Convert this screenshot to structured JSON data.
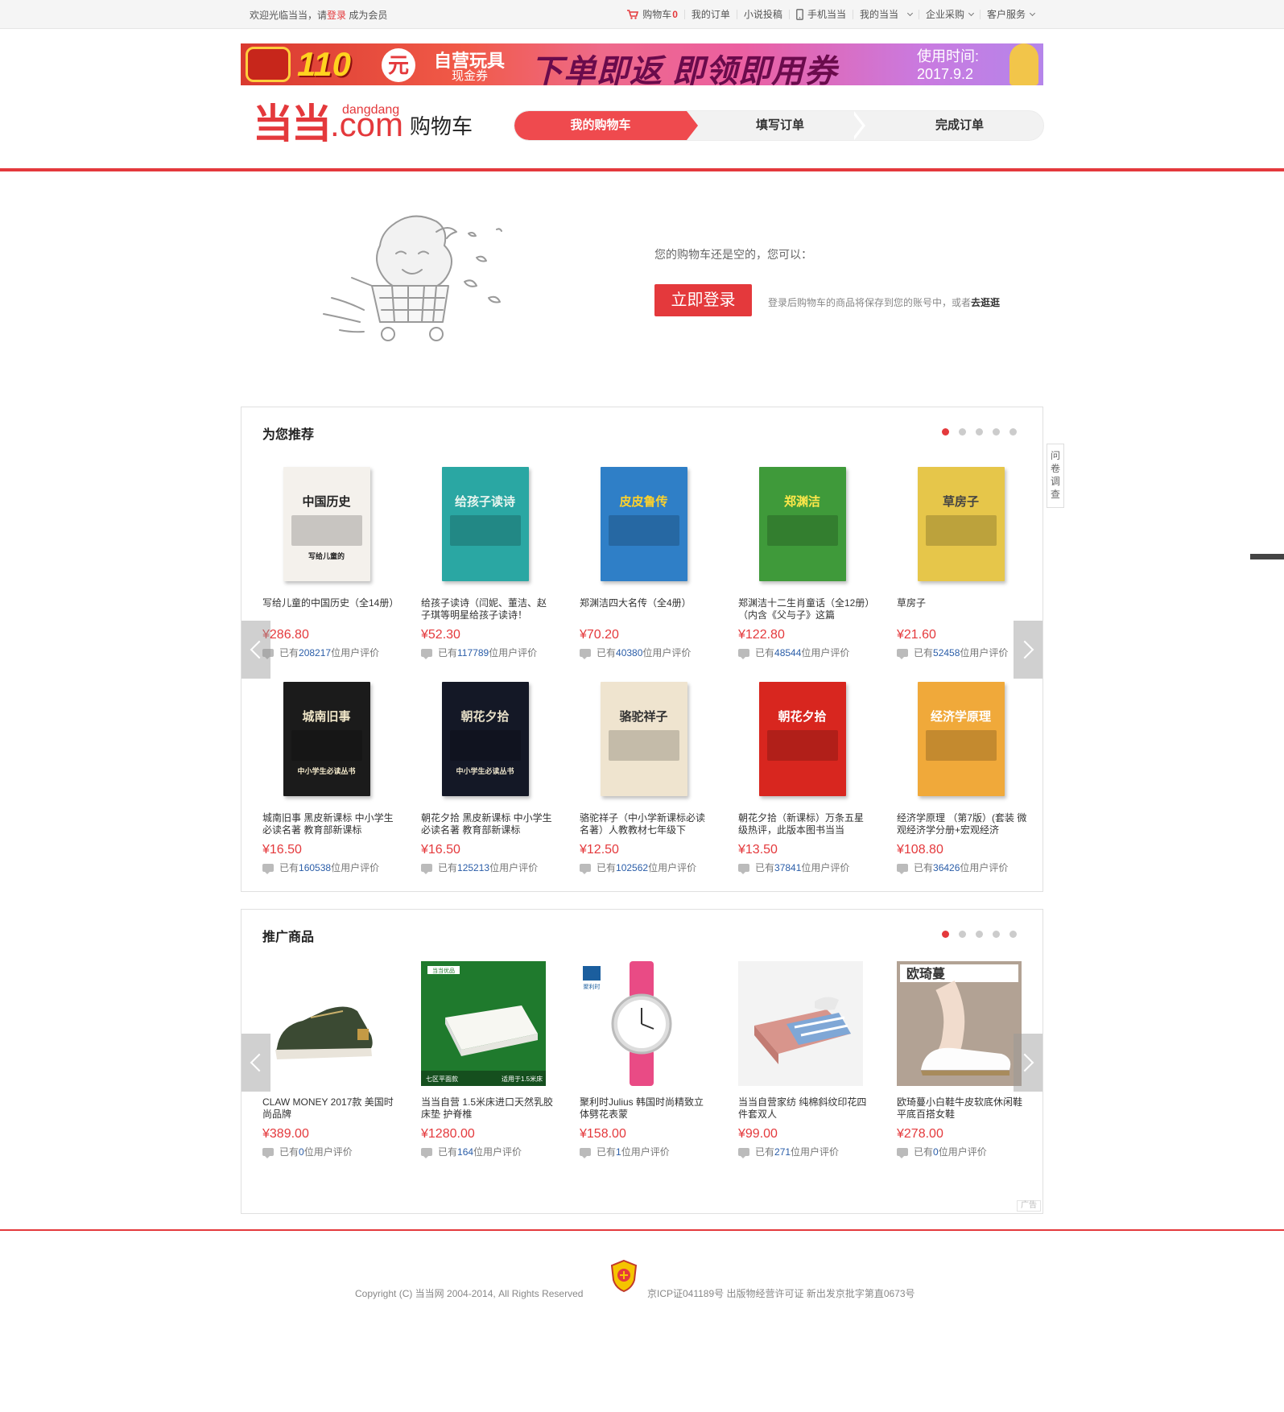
{
  "topbar": {
    "welcome_prefix": "欢迎光临当当，请",
    "login_link": "登录",
    "welcome_suffix": "成为会员",
    "cart_label": "购物车",
    "cart_count": "0",
    "orders": "我的订单",
    "novel": "小说投稿",
    "mobile": "手机当当",
    "my_dd": "我的当当",
    "enterprise": "企业采购",
    "service": "客户服务"
  },
  "banner": {
    "amount": "110",
    "unit": "元",
    "line1": "自营玩具",
    "line2": "现金券",
    "headline": "下单即返 即领即用券",
    "time_label": "使用时间:",
    "time_value": "2017.9.2"
  },
  "header": {
    "logo_sub": "dangdang",
    "logo_main": "当当",
    "logo_com": ".com",
    "cart_title": "购物车",
    "steps": [
      "我的购物车",
      "填写订单",
      "完成订单"
    ]
  },
  "empty": {
    "message": "您的购物车还是空的，您可以：",
    "login_button": "立即登录",
    "note": "登录后购物车的商品将保存到您的账号中，或者",
    "browse_link": "去逛逛"
  },
  "recommend": {
    "title": "为您推荐",
    "items": [
      {
        "name": "写给儿童的中国历史（全14册）",
        "price": "¥286.80",
        "rev_pre": "已有",
        "rev_num": "208217",
        "rev_post": "位用户评价"
      },
      {
        "name": "给孩子读诗（闫妮、董洁、赵子琪等明星给孩子读诗！",
        "price": "¥52.30",
        "rev_pre": "已有",
        "rev_num": "117789",
        "rev_post": "位用户评价"
      },
      {
        "name": "郑渊洁四大名传（全4册）",
        "price": "¥70.20",
        "rev_pre": "已有",
        "rev_num": "40380",
        "rev_post": "位用户评价"
      },
      {
        "name": "郑渊洁十二生肖童话（全12册）（内含《父与子》这篇",
        "price": "¥122.80",
        "rev_pre": "已有",
        "rev_num": "48544",
        "rev_post": "位用户评价"
      },
      {
        "name": "草房子",
        "price": "¥21.60",
        "rev_pre": "已有",
        "rev_num": "52458",
        "rev_post": "位用户评价"
      },
      {
        "name": "城南旧事 黑皮新课标 中小学生必读名著 教育部新课标",
        "price": "¥16.50",
        "rev_pre": "已有",
        "rev_num": "160538",
        "rev_post": "位用户评价"
      },
      {
        "name": "朝花夕拾 黑皮新课标 中小学生必读名著 教育部新课标",
        "price": "¥16.50",
        "rev_pre": "已有",
        "rev_num": "125213",
        "rev_post": "位用户评价"
      },
      {
        "name": "骆驼祥子（中小学新课标必读名著）人教教材七年级下",
        "price": "¥12.50",
        "rev_pre": "已有",
        "rev_num": "102562",
        "rev_post": "位用户评价"
      },
      {
        "name": "朝花夕拾（新课标）万条五星级热评，此版本图书当当",
        "price": "¥13.50",
        "rev_pre": "已有",
        "rev_num": "37841",
        "rev_post": "位用户评价"
      },
      {
        "name": "经济学原理 （第7版）(套装 微观经济学分册+宏观经济",
        "price": "¥108.80",
        "rev_pre": "已有",
        "rev_num": "36426",
        "rev_post": "位用户评价"
      }
    ],
    "covers": [
      {
        "title": "中国历史",
        "sub": "写给儿童的",
        "bg": "#f4f1ec",
        "fg": "#222"
      },
      {
        "title": "给孩子读诗",
        "sub": "",
        "bg": "#2aa7a3",
        "fg": "#e8f5ef"
      },
      {
        "title": "皮皮鲁传",
        "sub": "",
        "bg": "#2f7fc7",
        "fg": "#ffd22b"
      },
      {
        "title": "郑渊洁",
        "sub": "",
        "bg": "#3f9a3a",
        "fg": "#ffe84a"
      },
      {
        "title": "草房子",
        "sub": "",
        "bg": "#e6c64a",
        "fg": "#444"
      },
      {
        "title": "城南旧事",
        "sub": "中小学生必读丛书",
        "bg": "#1b1b1b",
        "fg": "#f0e6c8"
      },
      {
        "title": "朝花夕拾",
        "sub": "中小学生必读丛书",
        "bg": "#141826",
        "fg": "#e8e0c8"
      },
      {
        "title": "骆驼祥子",
        "sub": "",
        "bg": "#efe4cf",
        "fg": "#333"
      },
      {
        "title": "朝花夕拾",
        "sub": "",
        "bg": "#d8261f",
        "fg": "#fff"
      },
      {
        "title": "经济学原理",
        "sub": "",
        "bg": "#f0a93a",
        "fg": "#fff"
      }
    ]
  },
  "promo": {
    "title": "推广商品",
    "ad_label": "广告",
    "items": [
      {
        "name": "CLAW MONEY 2017款 美国时尚品牌",
        "price": "¥389.00",
        "rev_pre": "已有",
        "rev_num": "0",
        "rev_post": "位用户评价"
      },
      {
        "name": "当当自营 1.5米床进口天然乳胶床垫 护脊椎",
        "price": "¥1280.00",
        "rev_pre": "已有",
        "rev_num": "164",
        "rev_post": "位用户评价"
      },
      {
        "name": "聚利时Julius 韩国时尚精致立体劈花表蒙",
        "price": "¥158.00",
        "rev_pre": "已有",
        "rev_num": "1",
        "rev_post": "位用户评价"
      },
      {
        "name": "当当自营家纺 纯棉斜纹印花四件套双人",
        "price": "¥99.00",
        "rev_pre": "已有",
        "rev_num": "271",
        "rev_post": "位用户评价"
      },
      {
        "name": "欧琦蔓小白鞋牛皮软底休闲鞋平底百搭女鞋",
        "price": "¥278.00",
        "rev_pre": "已有",
        "rev_num": "0",
        "rev_post": "位用户评价"
      }
    ],
    "mattress_tag": "当当优品",
    "mattress_l": "七区平面款",
    "mattress_r": "适用于1.5米床",
    "watch_brand": "聚利时",
    "shoe_brand": "欧琦蔓"
  },
  "side": {
    "survey": "问卷调查"
  },
  "footer": {
    "copyright": "Copyright (C) 当当网 2004-2014, All Rights Reserved",
    "icp": "京ICP证041189号 出版物经营许可证 新出发京批字第直0673号"
  },
  "colors": {
    "brand_red": "#e4393c",
    "price_red": "#e4393c",
    "link_blue": "#2a5da8"
  }
}
